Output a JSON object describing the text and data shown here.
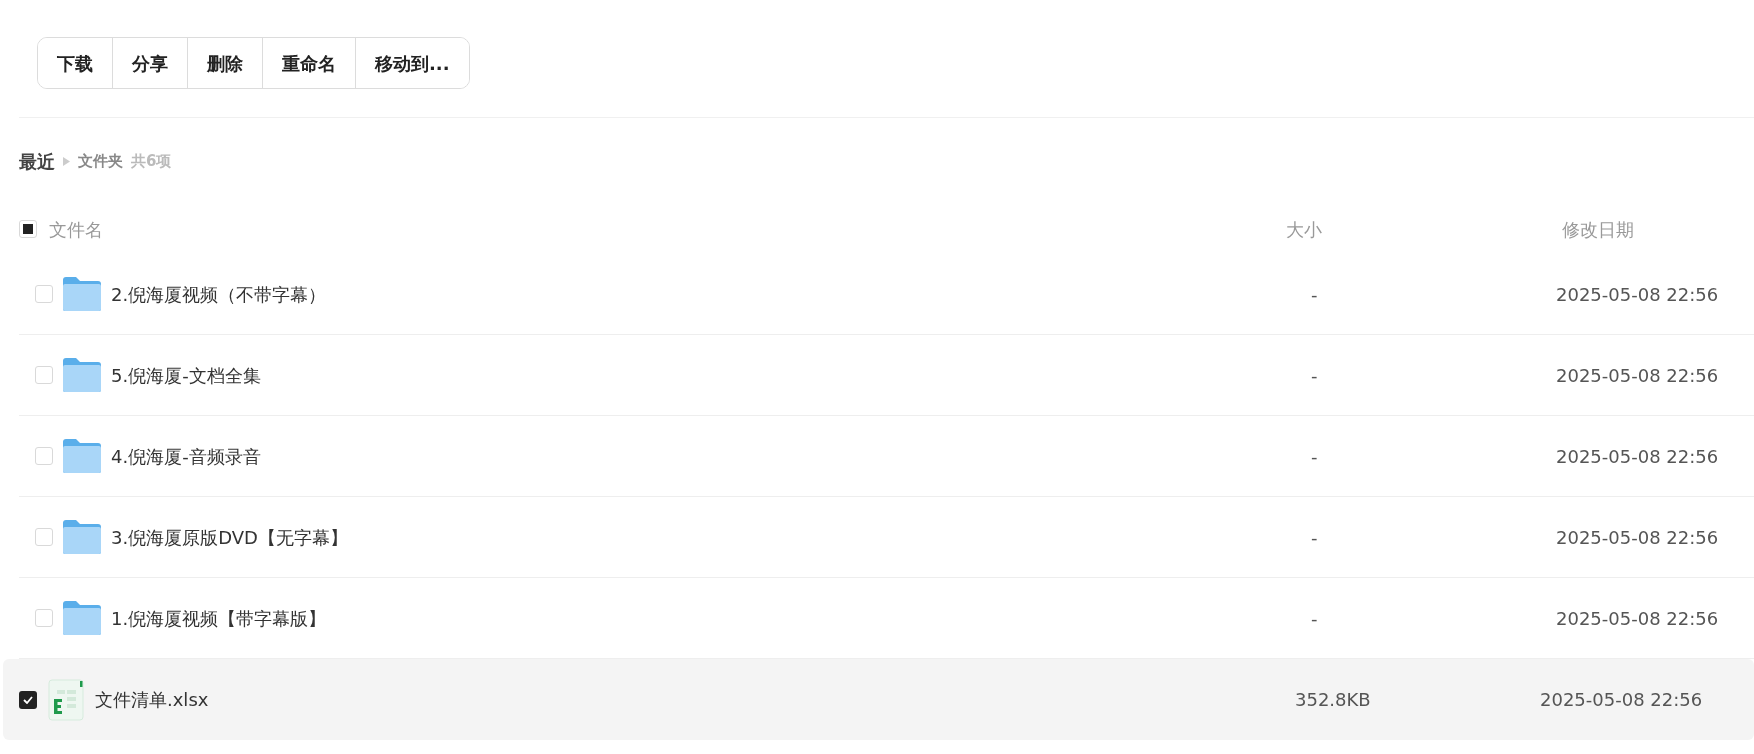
{
  "toolbar": [
    "下载",
    "分享",
    "删除",
    "重命名",
    "移动到..."
  ],
  "breadcrumb": {
    "root": "最近",
    "current": "文件夹",
    "count": "共6项"
  },
  "header": {
    "select_all_indeterminate": true,
    "columns": [
      "文件名",
      "大小",
      "修改日期"
    ]
  },
  "rows": [
    {
      "kind": "folder",
      "name": "2.倪海厦视频（不带字幕）",
      "size": "-",
      "modified": "2025-05-08 22:56",
      "checked": false,
      "selected": false
    },
    {
      "kind": "folder",
      "name": "5.倪海厦-文档全集",
      "size": "-",
      "modified": "2025-05-08 22:56",
      "checked": false,
      "selected": false
    },
    {
      "kind": "folder",
      "name": "4.倪海厦-音频录音",
      "size": "-",
      "modified": "2025-05-08 22:56",
      "checked": false,
      "selected": false
    },
    {
      "kind": "folder",
      "name": "3.倪海厦原版DVD【无字幕】",
      "size": "-",
      "modified": "2025-05-08 22:56",
      "checked": false,
      "selected": false
    },
    {
      "kind": "folder",
      "name": "1.倪海厦视频【带字幕版】",
      "size": "-",
      "modified": "2025-05-08 22:56",
      "checked": false,
      "selected": false
    },
    {
      "kind": "xlsx",
      "name": "文件清单.xlsx",
      "size": "352.8KB",
      "modified": "2025-05-08 22:56",
      "checked": true,
      "selected": true
    }
  ]
}
